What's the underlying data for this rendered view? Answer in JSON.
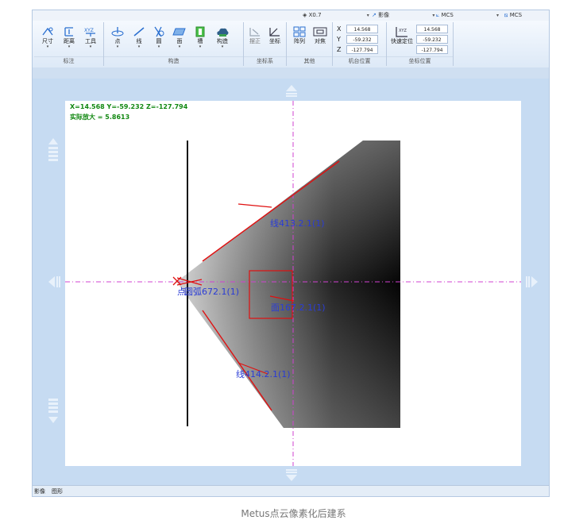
{
  "topbar": {
    "zoom_value": "X0.7",
    "mode_select": "影像",
    "coord_select_1": "MCS",
    "coord_select_2": "MCS"
  },
  "ribbon": {
    "groups": {
      "annotate": "标注",
      "construct": "构造",
      "coordsys": "坐标系",
      "other": "其他",
      "machine_pos": "机台位置",
      "coord_pos": "坐标位置"
    },
    "tools": {
      "size": "尺寸",
      "distance": "距离",
      "tool": "工具",
      "point": "点",
      "line": "线",
      "circle": "圆",
      "plane": "面",
      "slot": "槽",
      "construct": "构造",
      "level": "摆正",
      "coordinate": "坐标",
      "array": "阵列",
      "align": "对焦",
      "quick_locate": "快速定位"
    },
    "machine_pos": {
      "x": "14.568",
      "y": "-59.232",
      "z": "-127.794"
    },
    "coord_pos": {
      "x": "14.568",
      "y": "-59.232",
      "z": "-127.794"
    },
    "axis_labels": {
      "x": "X",
      "y": "Y",
      "z": "Z"
    }
  },
  "overlay": {
    "readout": "X=14.568 Y=-59.232 Z=-127.794",
    "scale": "实际放大 = 5.8613"
  },
  "labels": {
    "line_top": "线413.2.1(1)",
    "point": "点",
    "circle": "圆弧672.1(1)",
    "plane": "面167.2.1(1)",
    "line_bottom": "线414.2.1(1)"
  },
  "status": {
    "tab_image": "影像",
    "tab_graphic": "图形"
  },
  "caption": "Metus点云像素化后建系",
  "colors": {
    "ribbon_bg": "#dde9f7",
    "viewport_bg": "#c6dbf2",
    "readout_text": "#118811",
    "label_text": "#2a3cd6",
    "measure_line": "#e01010",
    "crosshair": "#d040d0"
  }
}
